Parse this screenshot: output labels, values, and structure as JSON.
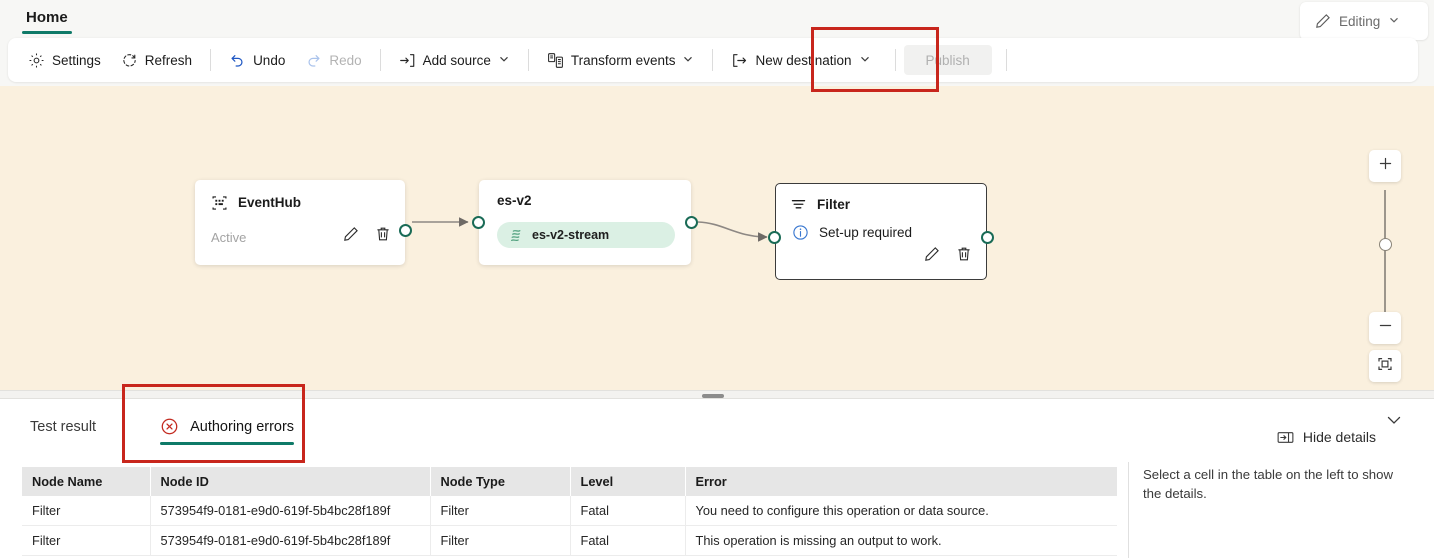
{
  "header": {
    "tab_label": "Home",
    "editing_label": "Editing",
    "editing_icon": "pencil-icon",
    "chevron_icon": "chevron-down-icon"
  },
  "toolbar": {
    "settings_label": "Settings",
    "refresh_label": "Refresh",
    "undo_label": "Undo",
    "redo_label": "Redo",
    "add_source_label": "Add source",
    "transform_events_label": "Transform events",
    "new_destination_label": "New destination",
    "publish_label": "Publish",
    "icons": {
      "settings": "gear-icon",
      "refresh": "refresh-icon",
      "undo": "undo-arrow-icon",
      "redo": "redo-arrow-icon",
      "add_source": "arrow-into-bracket-icon",
      "transform_events": "transform-events-icon",
      "new_destination": "bracket-arrow-out-icon",
      "caret": "chevron-down-icon"
    }
  },
  "canvas": {
    "nodes": [
      {
        "id": "eventhub",
        "title": "EventHub",
        "icon": "eventhub-icon",
        "status": "Active",
        "edit_icon": "pencil-icon",
        "delete_icon": "trash-icon"
      },
      {
        "id": "es-v2",
        "title": "es-v2",
        "stream_label": "es-v2-stream",
        "stream_icon": "stream-icon"
      },
      {
        "id": "filter",
        "title": "Filter",
        "icon": "filter-icon",
        "status": "Set-up required",
        "status_icon": "info-icon",
        "edit_icon": "pencil-icon",
        "delete_icon": "trash-icon"
      }
    ],
    "zoom_controls": {
      "zoom_in": "plus-icon",
      "zoom_out": "minus-icon",
      "fit_to_screen": "fit-to-screen-icon"
    }
  },
  "bottom_panel": {
    "tabs": [
      {
        "label": "Test result",
        "active": false,
        "icon": null
      },
      {
        "label": "Authoring errors",
        "active": true,
        "icon": "error-circle-x-icon"
      }
    ],
    "hide_details_label": "Hide details",
    "hide_details_icon": "panel-right-icon",
    "collapse_icon": "chevron-down-icon",
    "table": {
      "columns": [
        "Node Name",
        "Node ID",
        "Node Type",
        "Level",
        "Error"
      ],
      "rows": [
        {
          "node_name": "Filter",
          "node_id": "573954f9-0181-e9d0-619f-5b4bc28f189f",
          "node_type": "Filter",
          "level": "Fatal",
          "error": "You need to configure this operation or data source."
        },
        {
          "node_name": "Filter",
          "node_id": "573954f9-0181-e9d0-619f-5b4bc28f189f",
          "node_type": "Filter",
          "level": "Fatal",
          "error": "This operation is missing an output to work."
        }
      ]
    },
    "details_placeholder": "Select a cell in the table on the left to show the details."
  },
  "colors": {
    "accent_teal": "#0f7a68",
    "canvas_bg": "#faf0de",
    "annotation_red": "#c8261c",
    "port_green": "#1a6b56",
    "pill_bg": "#dbf0e4"
  }
}
